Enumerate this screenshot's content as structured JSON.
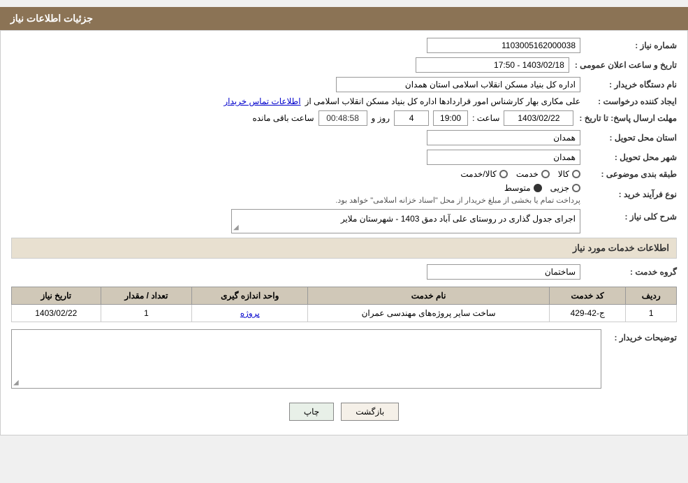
{
  "header": {
    "title": "جزئیات اطلاعات نیاز"
  },
  "fields": {
    "request_number_label": "شماره نیاز :",
    "request_number_value": "1103005162000038",
    "buyer_org_label": "نام دستگاه خریدار :",
    "buyer_org_value": "اداره کل بنیاد مسکن انقلاب اسلامی استان همدان",
    "requester_label": "ایجاد کننده درخواست :",
    "requester_value": "علی مکاری بهار کارشناس امور قراردادها اداره کل بنیاد مسکن انقلاب اسلامی از",
    "requester_link": "اطلاعات تماس خریدار",
    "deadline_label": "مهلت ارسال پاسخ: تا تاریخ :",
    "deadline_date": "1403/02/22",
    "deadline_time_label": "ساعت :",
    "deadline_time": "19:00",
    "days_label": "روز و",
    "days_count": "4",
    "remaining_label": "ساعت باقی مانده",
    "timer": "00:48:58",
    "province_label": "استان محل تحویل :",
    "province_value": "همدان",
    "city_label": "شهر محل تحویل :",
    "city_value": "همدان",
    "category_label": "طبقه بندی موضوعی :",
    "category_options": [
      {
        "label": "کالا",
        "selected": false
      },
      {
        "label": "خدمت",
        "selected": false
      },
      {
        "label": "کالا/خدمت",
        "selected": false
      }
    ],
    "purchase_type_label": "نوع فرآیند خرید :",
    "purchase_options": [
      {
        "label": "جزیی",
        "selected": false
      },
      {
        "label": "متوسط",
        "selected": true
      }
    ],
    "purchase_note": "پرداخت تمام یا بخشی از مبلغ خریدار از محل \"اسناد خزانه اسلامی\" خواهد بود.",
    "description_label": "شرح کلی نیاز :",
    "description_value": "اجرای جدول گذاری در روستای علی آباد دمق 1403 - شهرستان ملایر",
    "services_title": "اطلاعات خدمات مورد نیاز",
    "service_group_label": "گروه خدمت :",
    "service_group_value": "ساختمان",
    "table": {
      "headers": [
        "ردیف",
        "کد خدمت",
        "نام خدمت",
        "واحد اندازه گیری",
        "تعداد / مقدار",
        "تاریخ نیاز"
      ],
      "rows": [
        {
          "row": "1",
          "code": "ج-42-429",
          "name": "ساخت سایر پروژه‌های مهندسی عمران",
          "unit": "پروژه",
          "count": "1",
          "date": "1403/02/22"
        }
      ]
    },
    "buyer_desc_label": "توضیحات خریدار :",
    "buyer_desc_value": "",
    "buttons": {
      "print": "چاپ",
      "back": "بازگشت"
    }
  }
}
